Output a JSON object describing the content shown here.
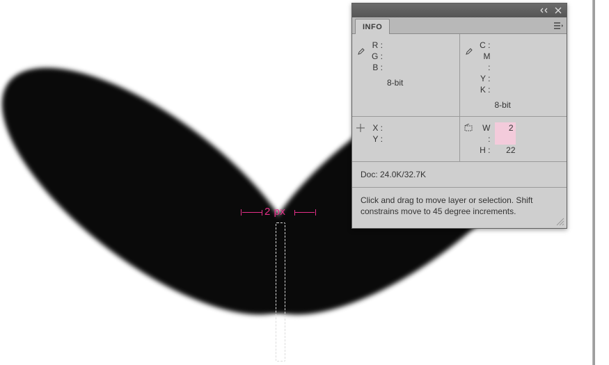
{
  "canvas_annotation": {
    "measurement_label": "2 px"
  },
  "panel": {
    "tab_label": "INFO",
    "rgb": {
      "r_label": "R :",
      "r_val": "",
      "g_label": "G :",
      "g_val": "",
      "b_label": "B :",
      "b_val": "",
      "depth": "8-bit"
    },
    "cmyk": {
      "c_label": "C :",
      "c_val": "",
      "m_label": "M :",
      "m_val": "",
      "y_label": "Y :",
      "y_val": "",
      "k_label": "K :",
      "k_val": "",
      "depth": "8-bit"
    },
    "coords": {
      "x_label": "X :",
      "x_val": "",
      "y_label": "Y :",
      "y_val": ""
    },
    "dims": {
      "w_label": "W :",
      "w_val": "2",
      "h_label": "H :",
      "h_val": "22"
    },
    "doc_line": "Doc: 24.0K/32.7K",
    "hint_text": "Click and drag to move layer or selection. Shift constrains move to 45 degree increments."
  }
}
